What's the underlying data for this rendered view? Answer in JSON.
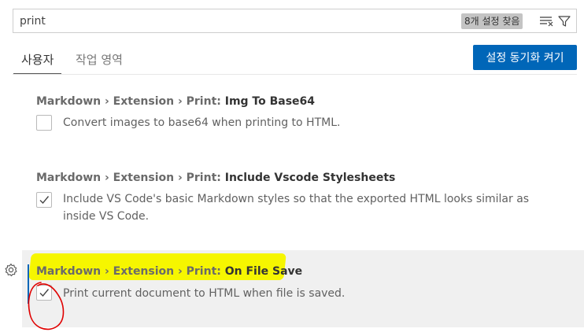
{
  "search": {
    "value": "print",
    "result_count": "8개 설정 찾음",
    "clear_icon": "clear-filter-icon",
    "filter_icon": "filter-icon"
  },
  "tabs": [
    {
      "label": "사용자",
      "active": true
    },
    {
      "label": "작업 영역",
      "active": false
    }
  ],
  "sync_button": {
    "label": "설정 동기화 켜기"
  },
  "settings": [
    {
      "category": "Markdown › Extension › Print: ",
      "key": "Img To Base64",
      "description": "Convert images to base64 when printing to HTML.",
      "checked": false
    },
    {
      "category": "Markdown › Extension › Print: ",
      "key": "Include Vscode Stylesheets",
      "description": "Include VS Code's basic Markdown styles so that the exported HTML looks similar as inside VS Code.",
      "checked": true
    },
    {
      "category": "Markdown › Extension › Print: ",
      "key": "On File Save",
      "description": "Print current document to HTML when file is saved.",
      "checked": true,
      "focused": true
    }
  ],
  "colors": {
    "accent": "#0066b8",
    "highlight": "#f6f600",
    "annotation": "#e00000"
  }
}
